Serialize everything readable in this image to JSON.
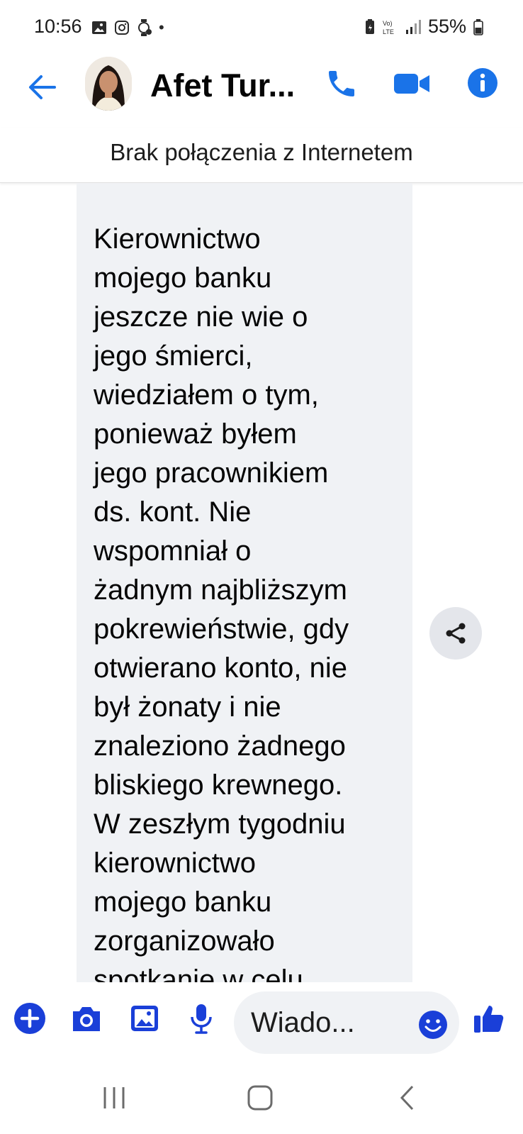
{
  "status_bar": {
    "time": "10:56",
    "battery": "55%",
    "network": "VoLTE"
  },
  "header": {
    "contact_name": "Afet Tur...",
    "accent_color": "#1a73e8"
  },
  "banner": {
    "text": "Brak połączenia z Internetem"
  },
  "message": {
    "text": "Kierownictwo mojego banku jeszcze nie wie o jego śmierci, wiedziałem o tym, ponieważ byłem jego pracownikiem ds. kont. Nie wspomniał o żadnym najbliższym pokrewieństwie, gdy otwierano konto, nie był żonaty i nie znaleziono żadnego bliskiego krewnego. W zeszłym tygodniu kierownictwo mojego banku zorganizowało spotkanie w celu",
    "lines": [
      "Kierownictwo",
      "mojego banku",
      "jeszcze nie wie o",
      "jego śmierci,",
      "wiedziałem o tym,",
      "ponieważ byłem",
      "jego pracownikiem",
      "ds. kont. Nie",
      "wspomniał o",
      "żadnym najbliższym",
      "pokrewieństwie, gdy",
      "otwierano konto, nie",
      "był żonaty i nie",
      "znaleziono żadnego",
      "bliskiego krewnego.",
      "W zeszłym tygodniu",
      "kierownictwo",
      "mojego banku",
      "zorganizowało",
      "spotkanie w celu"
    ]
  },
  "composer": {
    "input_value": "Wiado..."
  },
  "icons": {
    "back": "arrow-left-icon",
    "call": "phone-icon",
    "video": "video-camera-icon",
    "info": "info-icon",
    "share": "share-icon",
    "add": "plus-circle-icon",
    "camera": "camera-icon",
    "gallery": "image-icon",
    "mic": "microphone-icon",
    "emoji": "smiley-icon",
    "like": "thumbs-up-icon"
  }
}
